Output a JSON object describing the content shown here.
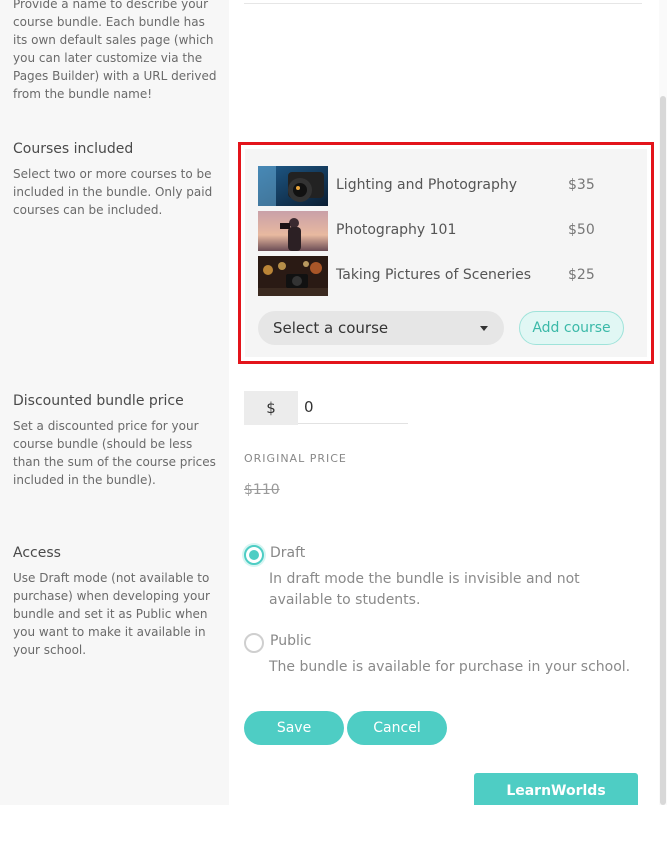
{
  "name_section": {
    "desc": "Provide a name to describe your course bundle. Each bundle has its own default sales page (which you can later customize via the Pages Builder) with a URL derived from the bundle name!"
  },
  "courses_section": {
    "title": "Courses included",
    "desc": "Select two or more courses to be included in the bundle. Only paid courses can be included.",
    "courses": [
      {
        "name": "Lighting and Photography",
        "price": "$35",
        "thumb": "camera-image"
      },
      {
        "name": "Photography 101",
        "price": "$50",
        "thumb": "photographer-image"
      },
      {
        "name": "Taking Pictures of Sceneries",
        "price": "$25",
        "thumb": "night-scene-image"
      }
    ],
    "select_placeholder": "Select a course",
    "add_label": "Add course"
  },
  "price_section": {
    "title": "Discounted bundle price",
    "desc": "Set a discounted price for your course bundle (should be less than the sum of the course prices included in the bundle).",
    "currency": "$",
    "value": "0",
    "original_label": "ORIGINAL PRICE",
    "original_value": "$110"
  },
  "access_section": {
    "title": "Access",
    "desc": "Use Draft mode (not available to purchase) when developing your bundle and set it as Public when you want to make it available in your school.",
    "options": [
      {
        "label": "Draft",
        "desc": "In draft mode the bundle is invisible and not available to students.",
        "selected": true
      },
      {
        "label": "Public",
        "desc": "The bundle is available for purchase in your school.",
        "selected": false
      }
    ]
  },
  "actions": {
    "save": "Save",
    "cancel": "Cancel"
  },
  "support_label": "LearnWorlds Support",
  "colors": {
    "accent": "#4ecdc4",
    "highlight_border": "#e3141b"
  }
}
